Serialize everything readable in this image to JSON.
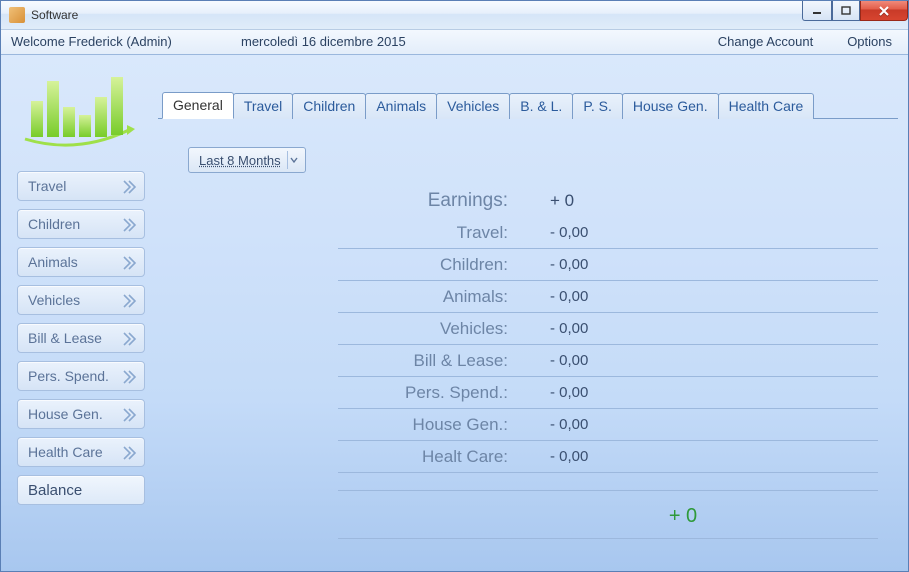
{
  "window": {
    "title": "Software"
  },
  "infobar": {
    "welcome": "Welcome Frederick   (Admin)",
    "date": "mercoledì 16 dicembre 2015",
    "change_account": "Change Account",
    "options": "Options"
  },
  "sidebar": {
    "items": [
      {
        "label": "Travel"
      },
      {
        "label": "Children"
      },
      {
        "label": "Animals"
      },
      {
        "label": "Vehicles"
      },
      {
        "label": "Bill & Lease"
      },
      {
        "label": "Pers. Spend."
      },
      {
        "label": "House Gen."
      },
      {
        "label": "Health Care"
      }
    ],
    "balance": "Balance"
  },
  "tabs": [
    {
      "label": "General"
    },
    {
      "label": "Travel"
    },
    {
      "label": "Children"
    },
    {
      "label": "Animals"
    },
    {
      "label": "Vehicles"
    },
    {
      "label": "B. & L."
    },
    {
      "label": "P. S."
    },
    {
      "label": "House Gen."
    },
    {
      "label": "Health Care"
    }
  ],
  "period": {
    "selected": "Last 8 Months"
  },
  "summary": {
    "earnings_label": "Earnings:",
    "earnings_value": "+ 0",
    "rows": [
      {
        "label": "Travel:",
        "value": "- 0,00"
      },
      {
        "label": "Children:",
        "value": "- 0,00"
      },
      {
        "label": "Animals:",
        "value": "- 0,00"
      },
      {
        "label": "Vehicles:",
        "value": "- 0,00"
      },
      {
        "label": "Bill & Lease:",
        "value": "- 0,00"
      },
      {
        "label": "Pers. Spend.:",
        "value": "- 0,00"
      },
      {
        "label": "House Gen.:",
        "value": "- 0,00"
      },
      {
        "label": "Healt Care:",
        "value": "- 0,00"
      }
    ],
    "total": "+ 0"
  }
}
